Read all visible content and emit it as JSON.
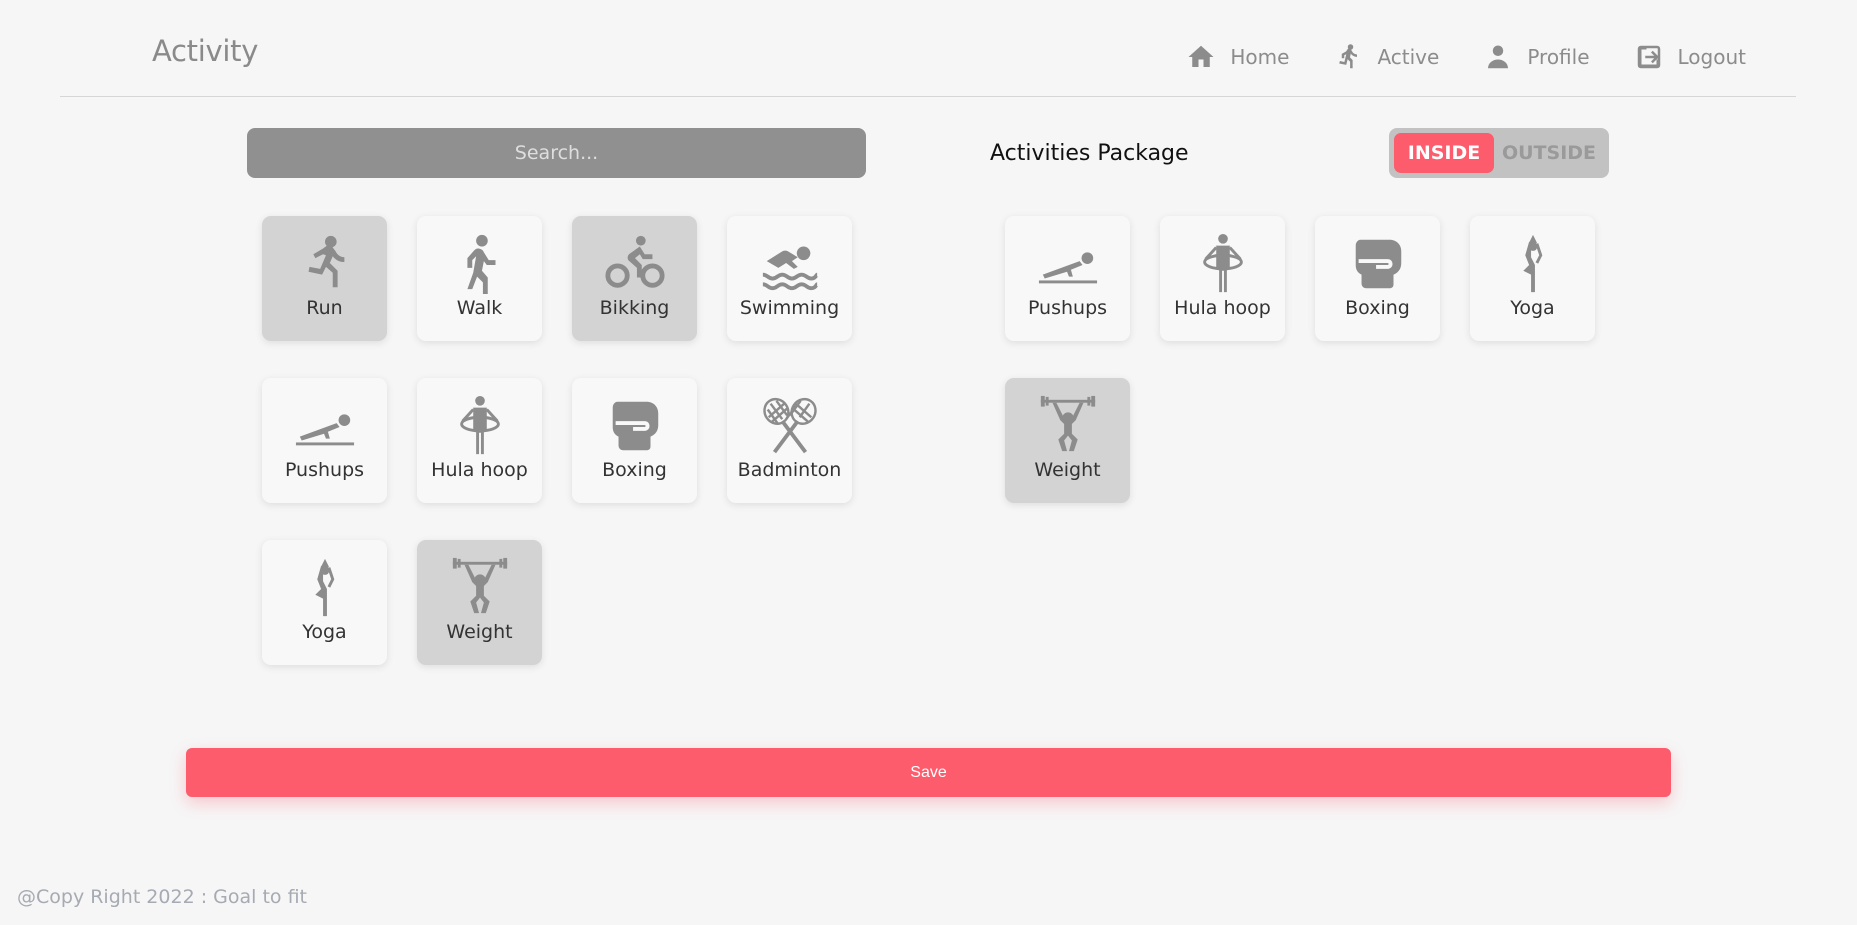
{
  "header": {
    "title": "Activity",
    "nav": [
      {
        "label": "Home",
        "icon": "home-icon"
      },
      {
        "label": "Active",
        "icon": "running-icon"
      },
      {
        "label": "Profile",
        "icon": "user-icon"
      },
      {
        "label": "Logout",
        "icon": "logout-icon"
      }
    ]
  },
  "search": {
    "placeholder": "Search..."
  },
  "activities": [
    {
      "label": "Run",
      "icon": "run-icon",
      "selected": true
    },
    {
      "label": "Walk",
      "icon": "walk-icon",
      "selected": false
    },
    {
      "label": "Bikking",
      "icon": "bike-icon",
      "selected": true
    },
    {
      "label": "Swimming",
      "icon": "swimming-icon",
      "selected": false
    },
    {
      "label": "Pushups",
      "icon": "pushups-icon",
      "selected": false
    },
    {
      "label": "Hula hoop",
      "icon": "hula-hoop-icon",
      "selected": false
    },
    {
      "label": "Boxing",
      "icon": "boxing-glove-icon",
      "selected": false
    },
    {
      "label": "Badminton",
      "icon": "badminton-icon",
      "selected": false
    },
    {
      "label": "Yoga",
      "icon": "yoga-icon",
      "selected": false
    },
    {
      "label": "Weight",
      "icon": "weightlifting-icon",
      "selected": true
    }
  ],
  "package": {
    "title": "Activities Package",
    "toggle": {
      "inside": "INSIDE",
      "outside": "OUTSIDE",
      "active": "inside"
    },
    "items": [
      {
        "label": "Pushups",
        "icon": "pushups-icon",
        "selected": false
      },
      {
        "label": "Hula hoop",
        "icon": "hula-hoop-icon",
        "selected": false
      },
      {
        "label": "Boxing",
        "icon": "boxing-glove-icon",
        "selected": false
      },
      {
        "label": "Yoga",
        "icon": "yoga-icon",
        "selected": false
      },
      {
        "label": "Weight",
        "icon": "weightlifting-icon",
        "selected": true
      }
    ]
  },
  "save_label": "Save",
  "footer": "@Copy Right 2022 : Goal to fit",
  "colors": {
    "accent": "#fc5c6c",
    "icon": "#8c8c8c",
    "selected_tile": "#d3d3d3"
  }
}
